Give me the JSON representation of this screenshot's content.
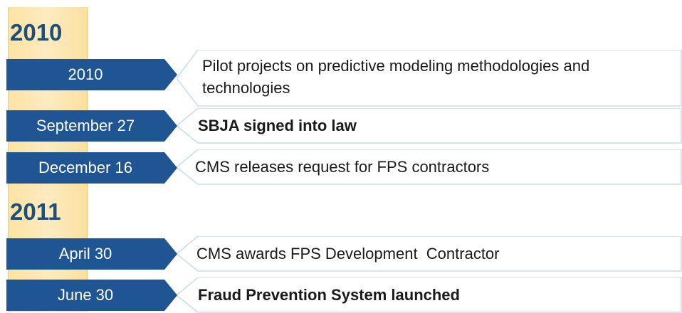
{
  "years": [
    "2010",
    "2011"
  ],
  "events": [
    {
      "date": "2010",
      "text": "Pilot projects on predictive modeling methodologies and technologies",
      "bold": false
    },
    {
      "date": "September 27",
      "text": "SBJA signed into law",
      "bold": true
    },
    {
      "date": "December 16",
      "text": "CMS releases request for FPS contractors",
      "bold": false
    },
    {
      "date": "April 30",
      "text": "CMS awards FPS Development  Contractor",
      "bold": false
    },
    {
      "date": "June 30",
      "text": "Fraud Prevention System launched",
      "bold": true
    }
  ],
  "colors": {
    "arrow": "#1f5592",
    "year": "#1f4e79",
    "spine": "#fde3a4",
    "card_border": "#c9dcea"
  }
}
